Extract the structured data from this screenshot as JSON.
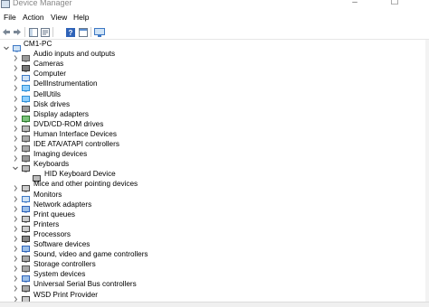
{
  "window": {
    "title": "Device Manager",
    "buttons": [
      "minimize-icon",
      "maximize-icon",
      "close-icon"
    ]
  },
  "menu": [
    "File",
    "Action",
    "View",
    "Help"
  ],
  "toolbar": [
    "back-icon",
    "forward-icon",
    "show-hide-tree-icon",
    "properties-icon",
    "help-icon",
    "details-icon",
    "monitor-icon"
  ],
  "tree": {
    "root": {
      "label": "CM1-PC",
      "expanded": true,
      "icon": "computer-icon"
    },
    "items": [
      {
        "label": "Audio inputs and outputs",
        "icon": "speaker-icon",
        "expanded": false
      },
      {
        "label": "Cameras",
        "icon": "camera-icon",
        "expanded": false
      },
      {
        "label": "Computer",
        "icon": "monitor-icon",
        "expanded": false
      },
      {
        "label": "DellInstrumentation",
        "icon": "device-icon",
        "expanded": false
      },
      {
        "label": "DellUtils",
        "icon": "device-icon",
        "expanded": false
      },
      {
        "label": "Disk drives",
        "icon": "disk-icon",
        "expanded": false
      },
      {
        "label": "Display adapters",
        "icon": "display-adapter-icon",
        "expanded": false
      },
      {
        "label": "DVD/CD-ROM drives",
        "icon": "dvd-icon",
        "expanded": false
      },
      {
        "label": "Human Interface Devices",
        "icon": "hid-icon",
        "expanded": false
      },
      {
        "label": "IDE ATA/ATAPI controllers",
        "icon": "ide-icon",
        "expanded": false
      },
      {
        "label": "Imaging devices",
        "icon": "imaging-icon",
        "expanded": false
      },
      {
        "label": "Keyboards",
        "icon": "keyboard-icon",
        "expanded": true,
        "children": [
          "HID Keyboard Device"
        ]
      },
      {
        "label": "Mice and other pointing devices",
        "icon": "mouse-icon",
        "expanded": false
      },
      {
        "label": "Monitors",
        "icon": "monitor-icon",
        "expanded": false
      },
      {
        "label": "Network adapters",
        "icon": "network-icon",
        "expanded": false
      },
      {
        "label": "Print queues",
        "icon": "printer-icon",
        "expanded": false
      },
      {
        "label": "Printers",
        "icon": "printer-icon",
        "expanded": false
      },
      {
        "label": "Processors",
        "icon": "processor-icon",
        "expanded": false
      },
      {
        "label": "Software devices",
        "icon": "software-icon",
        "expanded": false
      },
      {
        "label": "Sound, video and game controllers",
        "icon": "sound-icon",
        "expanded": false
      },
      {
        "label": "Storage controllers",
        "icon": "storage-icon",
        "expanded": false
      },
      {
        "label": "System devices",
        "icon": "system-icon",
        "expanded": false
      },
      {
        "label": "Universal Serial Bus controllers",
        "icon": "usb-icon",
        "expanded": false
      },
      {
        "label": "WSD Print Provider",
        "icon": "printer-icon",
        "expanded": false
      }
    ]
  }
}
